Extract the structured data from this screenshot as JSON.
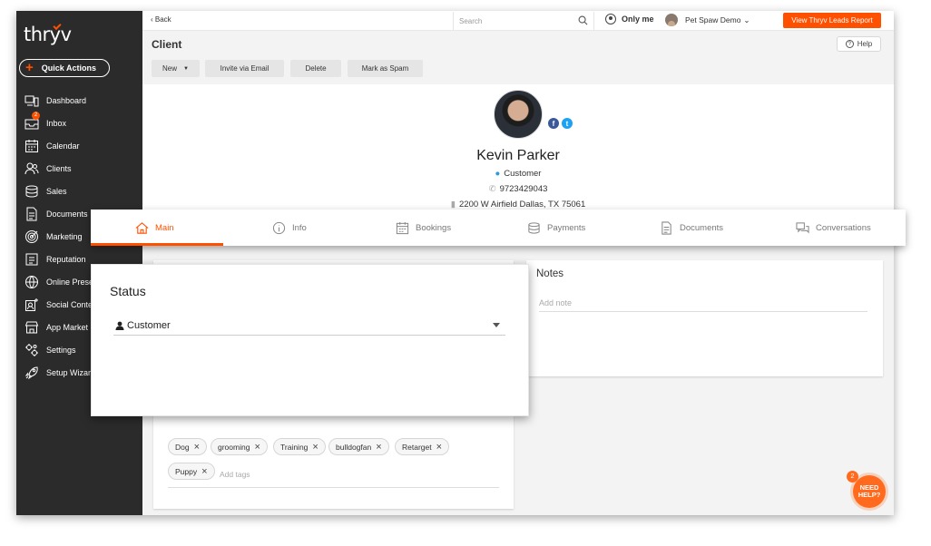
{
  "app": {
    "logo_text": "thryv"
  },
  "sidebar": {
    "quick_actions": "Quick Actions",
    "items": [
      {
        "label": "Dashboard",
        "icon": "dashboard-icon"
      },
      {
        "label": "Inbox",
        "icon": "inbox-icon",
        "badge": "2"
      },
      {
        "label": "Calendar",
        "icon": "calendar-icon"
      },
      {
        "label": "Clients",
        "icon": "clients-icon"
      },
      {
        "label": "Sales",
        "icon": "sales-icon"
      },
      {
        "label": "Documents",
        "icon": "documents-icon"
      },
      {
        "label": "Marketing",
        "icon": "marketing-icon"
      },
      {
        "label": "Reputation",
        "icon": "reputation-icon"
      },
      {
        "label": "Online Prese",
        "icon": "globe-icon"
      },
      {
        "label": "Social Conte",
        "icon": "social-icon"
      },
      {
        "label": "App Market",
        "icon": "store-icon"
      },
      {
        "label": "Settings",
        "icon": "settings-icon"
      },
      {
        "label": "Setup Wizard",
        "icon": "rocket-icon"
      }
    ]
  },
  "topbar": {
    "back": "Back",
    "search_placeholder": "Search",
    "only_me": "Only me",
    "account": "Pet Spaw Demo",
    "leads_button": "View Thryv Leads Report"
  },
  "page": {
    "title": "Client",
    "help": "Help",
    "actions": [
      "New",
      "Invite via Email",
      "Delete",
      "Mark as Spam"
    ]
  },
  "client": {
    "name": "Kevin Parker",
    "type": "Customer",
    "phone": "9723429043",
    "address": "2200 W Airfield Dallas, TX 75061"
  },
  "tabs": [
    "Main",
    "Info",
    "Bookings",
    "Payments",
    "Documents",
    "Conversations"
  ],
  "active_tab": "Main",
  "status": {
    "title": "Status",
    "value": "Customer"
  },
  "notes": {
    "title": "Notes",
    "placeholder": "Add note"
  },
  "tags": {
    "items": [
      "Dog",
      "grooming",
      "Training",
      "bulldogfan",
      "Retarget",
      "Puppy"
    ],
    "placeholder": "Add tags"
  },
  "help_widget": {
    "line1": "NEED",
    "line2": "HELP?",
    "badge": "2"
  },
  "colors": {
    "accent": "#ff5000",
    "sidebar_bg": "#2b2b2b",
    "facebook": "#3b5998",
    "twitter": "#1da1f2"
  }
}
